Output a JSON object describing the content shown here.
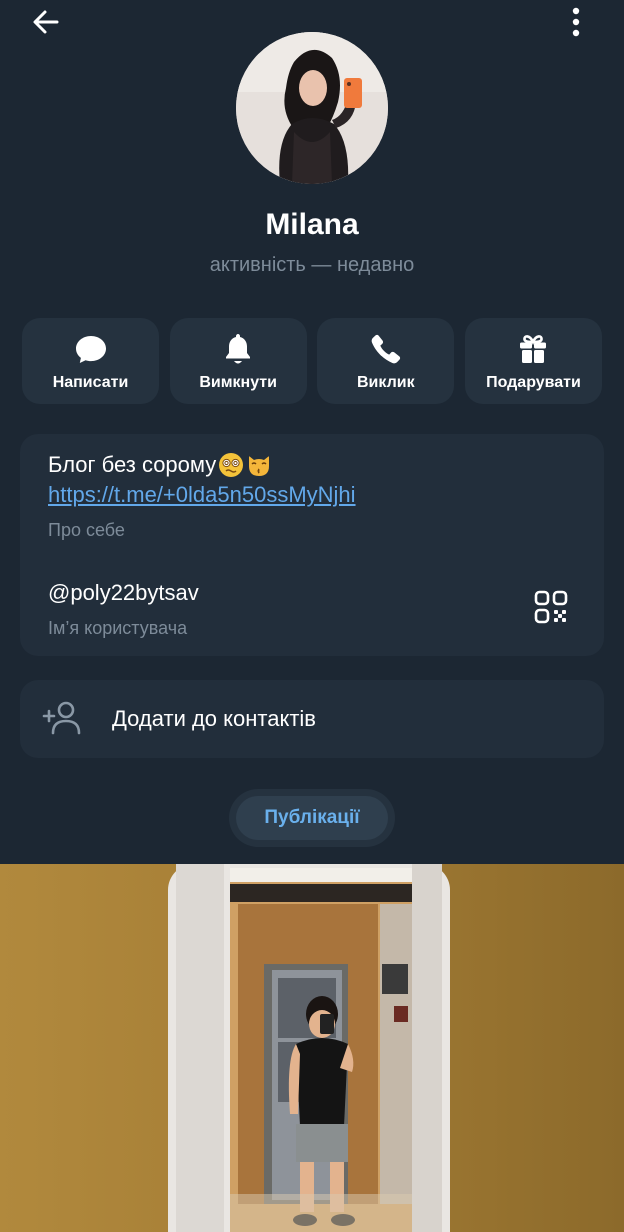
{
  "header": {
    "back_icon": "arrow-left-icon",
    "more_icon": "more-vertical-icon"
  },
  "profile": {
    "name": "Milana",
    "status": "активність — недавно"
  },
  "actions": [
    {
      "label": "Написати",
      "icon": "message-icon"
    },
    {
      "label": "Вимкнути",
      "icon": "bell-icon"
    },
    {
      "label": "Виклик",
      "icon": "phone-icon"
    },
    {
      "label": "Подарувати",
      "icon": "gift-icon"
    }
  ],
  "info": {
    "bio_text": "Блог без сорому",
    "bio_emojis": [
      "dizzy-face-emoji",
      "kissing-cat-emoji"
    ],
    "bio_link": "https://t.me/+0lda5n50ssMyNjhi",
    "bio_caption": "Про себе",
    "username": "@poly22bytsav",
    "username_caption": "Ім’я користувача",
    "qr_icon": "qr-code-icon"
  },
  "contacts": {
    "label": "Додати до контактів",
    "icon": "add-user-icon"
  },
  "tabs": {
    "publications": "Публікації"
  },
  "colors": {
    "background": "#1c2733",
    "card": "#222e3b",
    "button": "#25323f",
    "link": "#62a8ea",
    "secondary_text": "#7d8b99",
    "tab_text": "#6ab0ec"
  }
}
